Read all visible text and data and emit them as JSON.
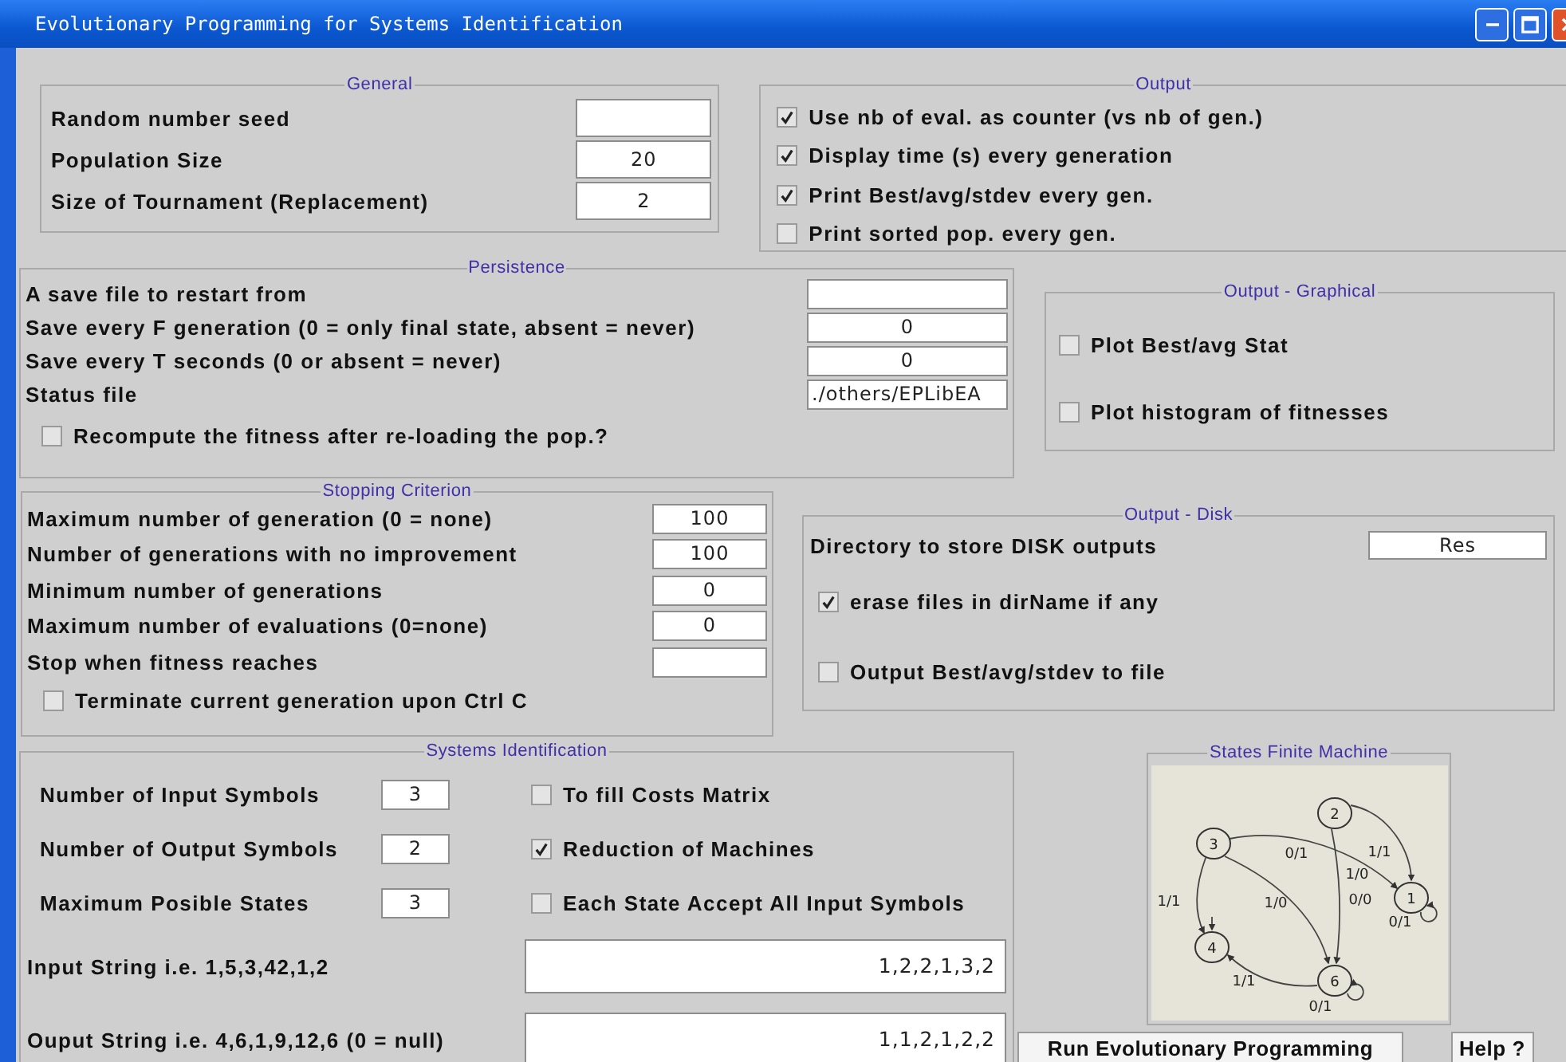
{
  "window": {
    "title": "Evolutionary Programming for Systems Identification"
  },
  "general": {
    "title": "General",
    "fields": [
      {
        "label": "Random number seed"
      },
      {
        "label": "Population Size",
        "value": "20"
      },
      {
        "label": "Size of Tournament (Replacement)",
        "value": "2"
      }
    ]
  },
  "output": {
    "title": "Output",
    "options": [
      {
        "label": "Use nb of eval. as counter (vs nb of gen.)",
        "checked": true
      },
      {
        "label": "Display time (s) every generation",
        "checked": true
      },
      {
        "label": "Print Best/avg/stdev every gen.",
        "checked": true
      },
      {
        "label": "Print sorted pop. every gen.",
        "checked": false
      }
    ]
  },
  "persistence": {
    "title": "Persistence",
    "fields": [
      {
        "label": "A save file to restart from"
      },
      {
        "label": "Save every F generation (0 = only final state, absent = never)",
        "value": "0"
      },
      {
        "label": "Save every T seconds (0 or absent = never)",
        "value": "0"
      },
      {
        "label": "Status file",
        "value": "./others/EPLibEA"
      }
    ],
    "options": [
      {
        "label": "Recompute the fitness after re-loading the pop.?",
        "checked": false
      }
    ]
  },
  "output_graphical": {
    "title": "Output - Graphical",
    "options": [
      {
        "label": "Plot Best/avg Stat",
        "checked": false
      },
      {
        "label": "Plot histogram of fitnesses",
        "checked": false
      }
    ]
  },
  "stopping_criterion": {
    "title": "Stopping Criterion",
    "fields": [
      {
        "label": "Maximum number of generation (0 = none)",
        "value": "100"
      },
      {
        "label": "Number of generations with no improvement",
        "value": "100"
      },
      {
        "label": "Minimum number of generations",
        "value": "0"
      },
      {
        "label": "Maximum number of evaluations (0=none)",
        "value": "0"
      },
      {
        "label": "Stop when fitness reaches"
      }
    ],
    "options": [
      {
        "label": "Terminate current generation upon Ctrl C",
        "checked": false
      }
    ]
  },
  "output_disk": {
    "title": "Output - Disk",
    "fields": [
      {
        "label": "Directory to store DISK outputs",
        "value": "Res"
      }
    ],
    "options": [
      {
        "label": "erase files in dirName if any",
        "checked": true
      },
      {
        "label": "Output Best/avg/stdev to file",
        "checked": false
      }
    ]
  },
  "systems_identification": {
    "title": "Systems Identification",
    "fields": [
      {
        "label": "Number of Input Symbols",
        "value": "3"
      },
      {
        "label": "Number of Output Symbols",
        "value": "2"
      },
      {
        "label": "Maximum Posible States",
        "value": "3"
      }
    ],
    "options": [
      {
        "label": "To fill Costs Matrix",
        "checked": false
      },
      {
        "label": "Reduction of Machines",
        "checked": true
      },
      {
        "label": "Each State Accept All Input Symbols",
        "checked": false
      }
    ],
    "strings": [
      {
        "label": "Input String i.e. 1,5,3,42,1,2",
        "value": "1,2,2,1,3,2"
      },
      {
        "label": "Ouput String i.e. 4,6,1,9,12,6 (0 = null)",
        "value": "1,1,2,1,2,2"
      }
    ]
  },
  "state_machine": {
    "title": "States Finite Machine",
    "nodes": [
      {
        "label": "2"
      },
      {
        "label": "3"
      },
      {
        "label": "1"
      },
      {
        "label": "4"
      },
      {
        "label": "6"
      }
    ],
    "edges": [
      {
        "label": "0/1"
      },
      {
        "label": "1/1"
      },
      {
        "label": "1/0"
      },
      {
        "label": "1/1"
      },
      {
        "label": "1/0"
      },
      {
        "label": "0/0"
      },
      {
        "label": "0/1"
      },
      {
        "label": "1/1"
      },
      {
        "label": "0/1"
      }
    ]
  },
  "buttons": [
    {
      "label": "Run Evolutionary Programming"
    },
    {
      "label": "Help ?"
    }
  ]
}
